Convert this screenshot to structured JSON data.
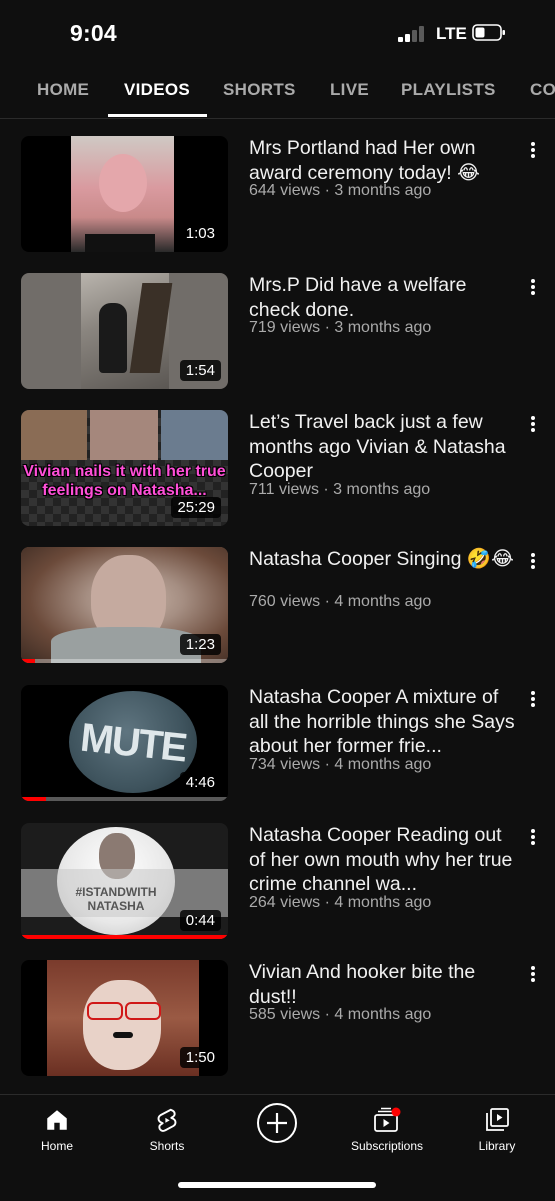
{
  "status": {
    "time": "9:04",
    "network": "LTE"
  },
  "tabs": [
    "HOME",
    "VIDEOS",
    "SHORTS",
    "LIVE",
    "PLAYLISTS",
    "CO"
  ],
  "active_tab": "VIDEOS",
  "videos": [
    {
      "title": "Mrs Portland had Her own award ceremony today! 😂",
      "meta": "644 views · 3 months ago",
      "duration": "1:03",
      "progress": 0
    },
    {
      "title": "Mrs.P Did have a welfare check done.",
      "meta": "719 views · 3 months ago",
      "duration": "1:54",
      "progress": 0
    },
    {
      "title": "Let’s Travel back just a few months ago Vivian & Natasha Cooper",
      "meta": "711 views · 3 months ago",
      "duration": "25:29",
      "progress": 0,
      "thumb_text": "Vivian nails it with her true feelings on Natasha..."
    },
    {
      "title": "Natasha Cooper Singing 🤣😂",
      "meta": "760 views · 4 months ago",
      "duration": "1:23",
      "progress": 0.07
    },
    {
      "title": "Natasha Cooper A mixture of all the horrible things she Says about her former frie...",
      "meta": "734 views · 4 months ago",
      "duration": "4:46",
      "progress": 0.12,
      "thumb_text": "MUTE"
    },
    {
      "title": "Natasha Cooper Reading out of her own mouth why her true crime channel wa...",
      "meta": "264 views · 4 months ago",
      "duration": "0:44",
      "progress": 1.0,
      "thumb_text": "#ISTANDWITH NATASHA"
    },
    {
      "title": "Vivian And hooker bite the dust!!",
      "meta": "585 views · 4 months ago",
      "duration": "1:50",
      "progress": 0
    }
  ],
  "nav": [
    {
      "label": "Home",
      "icon": "home-icon"
    },
    {
      "label": "Shorts",
      "icon": "shorts-icon"
    },
    {
      "label": "",
      "icon": "create-icon"
    },
    {
      "label": "Subscriptions",
      "icon": "subscriptions-icon"
    },
    {
      "label": "Library",
      "icon": "library-icon"
    }
  ],
  "colors": {
    "background": "#0f0f0f",
    "accent": "#ff0000",
    "secondary_text": "#aaaaaa"
  }
}
